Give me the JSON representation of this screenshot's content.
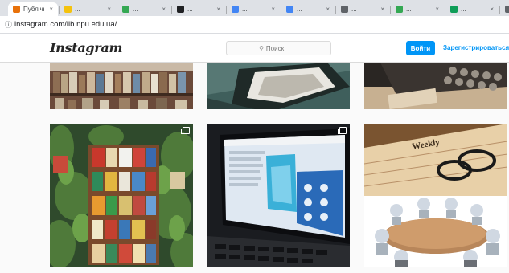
{
  "browser": {
    "tabs": [
      {
        "label": "Публічн...",
        "color": "#e8710a",
        "active": true
      },
      {
        "label": "...",
        "color": "#f4c20d",
        "active": false
      },
      {
        "label": "...",
        "color": "#34a853",
        "active": false
      },
      {
        "label": "...",
        "color": "#202124",
        "active": false
      },
      {
        "label": "...",
        "color": "#4285f4",
        "active": false
      },
      {
        "label": "...",
        "color": "#4285f4",
        "active": false
      },
      {
        "label": "...",
        "color": "#5f6368",
        "active": false
      },
      {
        "label": "...",
        "color": "#34a853",
        "active": false
      },
      {
        "label": "...",
        "color": "#0f9d58",
        "active": false
      },
      {
        "label": "...",
        "color": "#5f6368",
        "active": false
      }
    ],
    "url": "instagram.com/lib.npu.edu.ua/"
  },
  "header": {
    "logo": "Instagram",
    "search_placeholder": "Поиск",
    "login_label": "Войти",
    "signup_label": "Зарегистрироваться"
  },
  "colors": {
    "accent": "#0095f6",
    "page_bg": "#fafafa"
  },
  "posts": [
    {
      "name": "post-bookshelf",
      "subject": "library bookshelf",
      "multi": false
    },
    {
      "name": "post-desk-frame",
      "subject": "framed picture on desk",
      "multi": false
    },
    {
      "name": "post-typewriter",
      "subject": "typewriter keys",
      "multi": false
    },
    {
      "name": "post-book-display",
      "subject": "book display with plants",
      "multi": true
    },
    {
      "name": "post-laptop",
      "subject": "laptop screen",
      "multi": true
    },
    {
      "name": "post-planner-meeting",
      "subject": "weekly planner and meeting table",
      "multi": false
    }
  ],
  "post_texts": {
    "planner_word": "Weekly"
  }
}
